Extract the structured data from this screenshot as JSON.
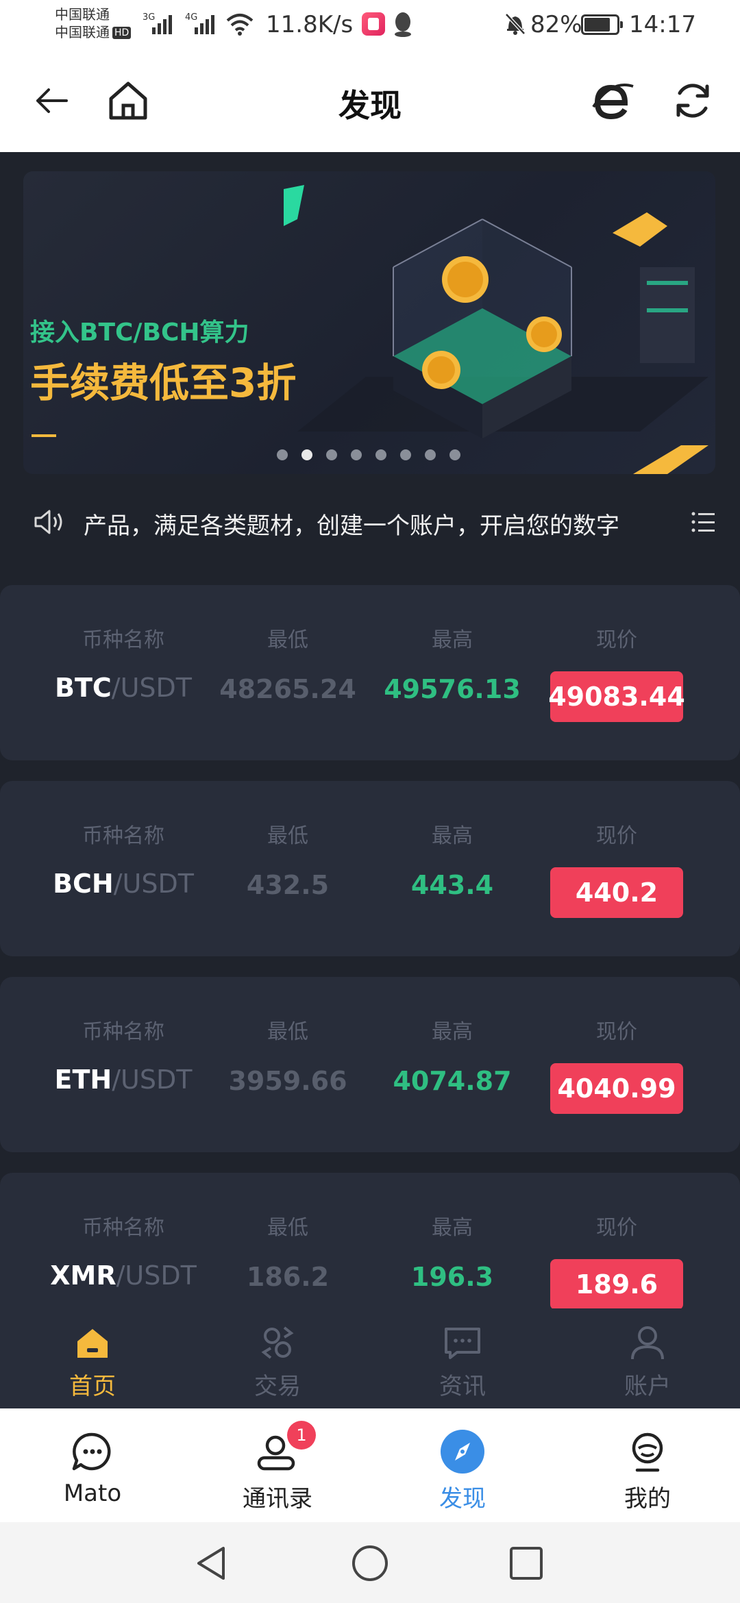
{
  "status_bar": {
    "carrier_1": "中国联通",
    "carrier_2": "中国联通",
    "hd": "HD",
    "sig1_tag": "3G",
    "sig2_tag": "4G",
    "net_speed": "11.8K/s",
    "battery": "82%",
    "battery_level": 0.82,
    "time": "14:17"
  },
  "header": {
    "title": "发现",
    "back_icon": "arrow-left-icon",
    "home_icon": "home-icon",
    "browser_icon": "ie-browser-icon",
    "refresh_icon": "refresh-icon"
  },
  "banner": {
    "subtitle": "接入BTC/BCH算力",
    "title": "手续费低至3折",
    "dot_count": 8,
    "active_dot": 1
  },
  "notice": {
    "text": "产品，满足各类题材，创建一个账户，开启您的数字",
    "icon": "speaker-icon",
    "menu_icon": "list-icon"
  },
  "market": {
    "col_name": "币种名称",
    "col_low": "最低",
    "col_high": "最高",
    "col_price": "现价",
    "items": [
      {
        "base": "BTC",
        "quote": "/USDT",
        "low": "48265.24",
        "high": "49576.13",
        "price": "49083.44"
      },
      {
        "base": "BCH",
        "quote": "/USDT",
        "low": "432.5",
        "high": "443.4",
        "price": "440.2"
      },
      {
        "base": "ETH",
        "quote": "/USDT",
        "low": "3959.66",
        "high": "4074.87",
        "price": "4040.99"
      },
      {
        "base": "XMR",
        "quote": "/USDT",
        "low": "186.2",
        "high": "196.3",
        "price": "189.6"
      }
    ]
  },
  "app_tabs": [
    {
      "label": "首页",
      "icon": "home-icon",
      "active": true
    },
    {
      "label": "交易",
      "icon": "exchange-icon",
      "active": false
    },
    {
      "label": "资讯",
      "icon": "message-icon",
      "active": false
    },
    {
      "label": "账户",
      "icon": "user-icon",
      "active": false
    }
  ],
  "host_tabs": [
    {
      "label": "Mato",
      "icon": "chat-icon",
      "active": false
    },
    {
      "label": "通讯录",
      "icon": "contacts-icon",
      "active": false,
      "badge": "1"
    },
    {
      "label": "发现",
      "icon": "compass-icon",
      "active": true
    },
    {
      "label": "我的",
      "icon": "profile-icon",
      "active": false
    }
  ],
  "colors": {
    "accent_gold": "#f5b93d",
    "up_green": "#2fbf82",
    "price_red": "#f0405a",
    "card_bg": "#282d3a",
    "host_active": "#3a8ee6"
  }
}
